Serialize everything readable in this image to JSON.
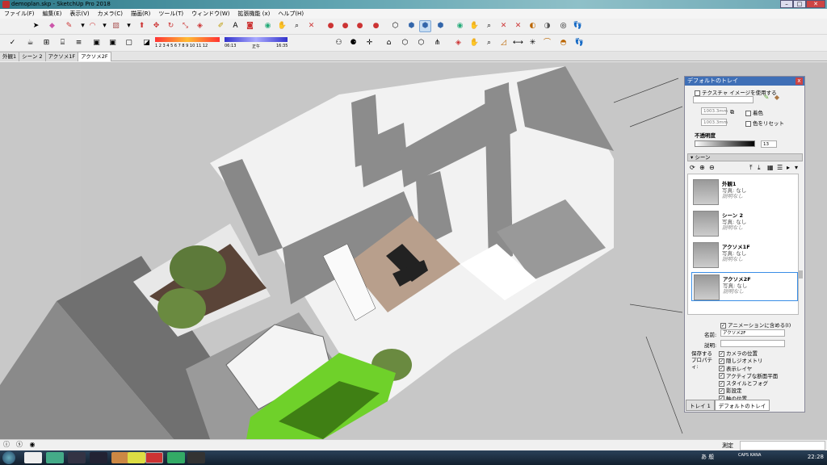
{
  "window": {
    "title": "demoplan.skp - SketchUp Pro 2018",
    "min": "–",
    "max": "□",
    "close": "✕"
  },
  "menu": [
    "ファイル(F)",
    "編集(E)",
    "表示(V)",
    "カメラ(C)",
    "描画(R)",
    "ツール(T)",
    "ウィンドウ(W)",
    "拡張機能 (x)",
    "ヘルプ(H)"
  ],
  "shadow_bar": {
    "months": "1 2 3 4 5 6 7 8 9 10 11 12",
    "time_start": "06:13",
    "time_noon": "正午",
    "time_end": "16:35"
  },
  "scene_tabs": [
    "外観1",
    "シーン 2",
    "アクソメ1F",
    "アクソメ2F"
  ],
  "active_scene_tab": "アクソメ2F",
  "tray": {
    "title": "デフォルトのトレイ",
    "close": "x",
    "use_texture_label": "テクスチャ イメージを使用する",
    "width": "1003.3mm",
    "height": "1003.3mm",
    "colorize_label": "着色",
    "reset_color": "色をリセット",
    "opacity_label": "不透明度",
    "opacity_value": "13",
    "scenes_header": "シーン",
    "scenes": [
      {
        "name": "外観1",
        "photo": "写真: なし",
        "desc": "説明なし"
      },
      {
        "name": "シーン 2",
        "photo": "写真: なし",
        "desc": "説明なし"
      },
      {
        "name": "アクソメ1F",
        "photo": "写真: なし",
        "desc": "説明なし"
      },
      {
        "name": "アクソメ2F",
        "photo": "写真: なし",
        "desc": "説明なし"
      }
    ],
    "include_animation": "アニメーションに含める(I)",
    "name_label": "名前:",
    "name_value": "アクソメ2F",
    "desc_label": "説明:",
    "save_props_label": "保存するプロパティ:",
    "props": [
      "カメラの位置",
      "隠しジオメトリ",
      "表示レイヤ",
      "アクティブな断面平面",
      "スタイルとフォグ",
      "影設定",
      "軸の位置"
    ],
    "bottom_tabs": [
      "トレイ 1",
      "デフォルトのトレイ"
    ]
  },
  "status": {
    "measure_label": "測定"
  },
  "taskbar": {
    "clock": "22:28",
    "ime": "あ 般",
    "caps": "CAPS KANA"
  }
}
